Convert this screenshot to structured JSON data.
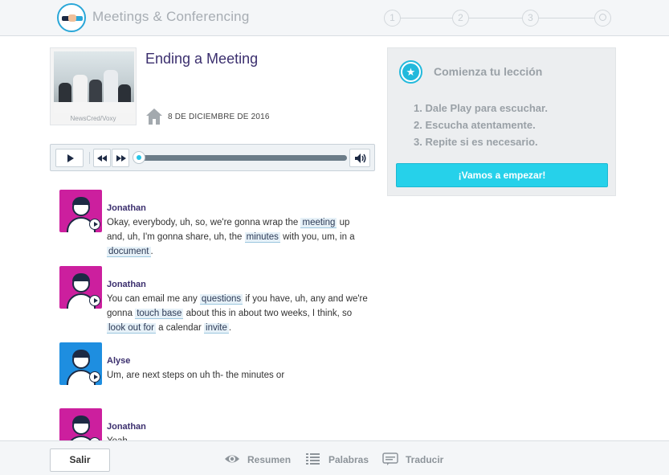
{
  "header": {
    "app_title": "Meetings & Conferencing",
    "steps": [
      "1",
      "2",
      "3"
    ]
  },
  "article": {
    "thumb_caption": "NewsCred/Voxy",
    "title": "Ending a Meeting",
    "date": "8 DE DICIEMBRE DE 2016"
  },
  "player": {
    "progress": 0
  },
  "transcript": [
    {
      "speaker": "Jonathan",
      "avatar_color": "#cc1f9e",
      "parts": [
        {
          "t": "Okay, everybody, uh, so, we're gonna wrap the "
        },
        {
          "k": "meeting"
        },
        {
          "t": " up and, uh, I'm gonna share, uh, the "
        },
        {
          "k": "minutes"
        },
        {
          "t": " with you, um, in a "
        },
        {
          "k": "document"
        },
        {
          "t": "."
        }
      ]
    },
    {
      "speaker": "Jonathan",
      "avatar_color": "#cc1f9e",
      "parts": [
        {
          "t": "You can email me any "
        },
        {
          "k": "questions"
        },
        {
          "t": " if you have, uh, any and we're gonna "
        },
        {
          "k": "touch base"
        },
        {
          "t": " about this in about two weeks, I think, so "
        },
        {
          "k": "look out for"
        },
        {
          "t": " a calendar "
        },
        {
          "k": "invite"
        },
        {
          "t": "."
        }
      ]
    },
    {
      "speaker": "Alyse",
      "avatar_color": "#1e8ee0",
      "parts": [
        {
          "t": "Um, are next steps on uh th- the minutes or"
        }
      ]
    },
    {
      "speaker": "Jonathan",
      "avatar_color": "#cc1f9e",
      "parts": [
        {
          "t": "Yeah."
        }
      ]
    }
  ],
  "panel": {
    "title": "Comienza tu lección",
    "steps": [
      "1. Dale Play para escuchar.",
      "2. Escucha atentamente.",
      "3. Repite si es necesario."
    ],
    "start_label": "¡Vamos a empezar!",
    "accent": "#26d1ea"
  },
  "footer": {
    "exit_label": "Salir",
    "tools": [
      {
        "label": "Resumen",
        "icon": "eye-icon"
      },
      {
        "label": "Palabras",
        "icon": "list-icon"
      },
      {
        "label": "Traducir",
        "icon": "translate-icon"
      }
    ]
  }
}
